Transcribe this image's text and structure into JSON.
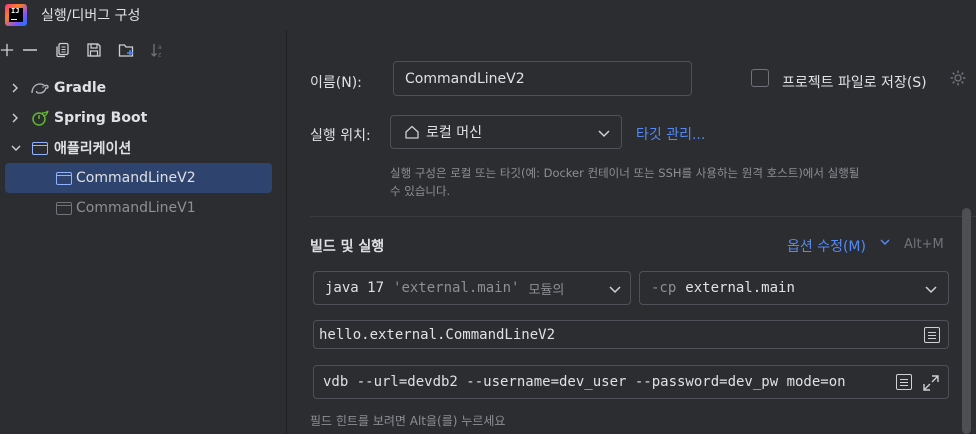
{
  "window": {
    "title": "실행/디버그 구성"
  },
  "toolbar": {
    "buttons": [
      "add-icon",
      "remove-icon",
      "copy-icon",
      "save-icon",
      "new-folder-icon",
      "sort-alpha-icon"
    ]
  },
  "tree": {
    "groups": [
      {
        "label": "Gradle",
        "expanded": false,
        "icon": "gradle-icon"
      },
      {
        "label": "Spring Boot",
        "expanded": false,
        "icon": "spring-boot-icon"
      },
      {
        "label": "애플리케이션",
        "expanded": true,
        "icon": "application-icon"
      }
    ],
    "children": [
      {
        "label": "CommandLineV2",
        "selected": true
      },
      {
        "label": "CommandLineV1",
        "selected": false
      }
    ]
  },
  "form": {
    "name_label": "이름(N):",
    "name_value": "CommandLineV2",
    "store_as_file_label": "프로젝트 파일로 저장(S)",
    "run_on_label": "실행 위치:",
    "run_on_value": "로컬 머신",
    "manage_targets_link": "타깃 관리...",
    "run_on_hint_line1": "실행 구성은 로컬 또는 타깃(예: Docker 컨테이너 또는 SSH를 사용하는 원격 호스트)에서 실행될",
    "run_on_hint_line2": "수 있습니다.",
    "build_run_title": "빌드 및 실행",
    "modify_options_link": "옵션 수정(M)",
    "modify_options_shortcut": "Alt+M",
    "jdk_keyword": "java 17",
    "jdk_module": "'external.main'",
    "jdk_suffix": "모듈의",
    "cp_flag": "-cp",
    "cp_value": "external.main",
    "main_class": "hello.external.CommandLineV2",
    "program_args": "vdb --url=devdb2 --username=dev_user --password=dev_pw mode=on",
    "field_hint": "필드 힌트를 보려면 Alt을(를) 누르세요"
  },
  "colors": {
    "background": "#2b2d30",
    "selection": "#2e436e",
    "link": "#548af7",
    "border": "#4e5157",
    "muted": "#8c8f94",
    "text": "#dfe1e5"
  }
}
